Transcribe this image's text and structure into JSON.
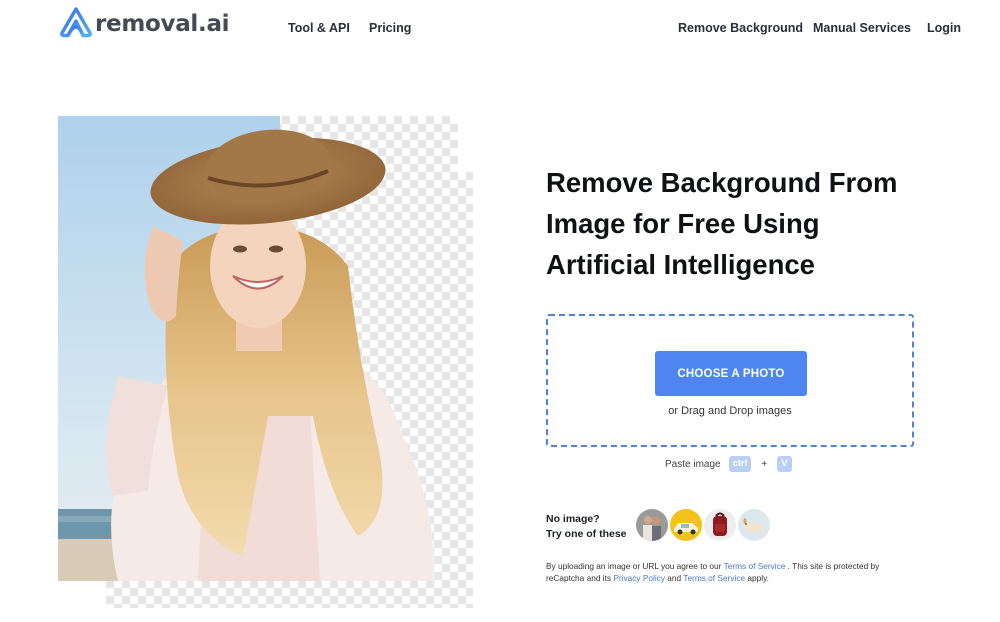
{
  "header": {
    "logo_text": "removal.ai",
    "nav_left": [
      "Tool & API",
      "Pricing"
    ],
    "nav_right": [
      "Remove Background",
      "Manual Services",
      "Login"
    ]
  },
  "hero": {
    "headline_lines": [
      "Remove Background From",
      "Image for Free Using",
      "Artificial Intelligence"
    ]
  },
  "upload": {
    "button_label": "CHOOSE A PHOTO",
    "drag_text": "or Drag and Drop images",
    "paste_label": "Paste image",
    "key_ctrl": "ctrl",
    "plus": "+",
    "key_v": "V"
  },
  "samples": {
    "line1": "No image?",
    "line2": "Try one of these",
    "items": [
      "sample-couple",
      "sample-car",
      "sample-backpack",
      "sample-dog"
    ]
  },
  "legal": {
    "p1": "By uploading an image or URL you agree to our ",
    "terms1": "Terms of Service",
    "p2": " . This site is protected by reCaptcha and its ",
    "privacy": "Privacy Policy",
    "p3": " and ",
    "terms2": "Terms of Service",
    "p4": " apply."
  },
  "colors": {
    "accent": "#4e85f0",
    "dropzone_border": "#4d84d6",
    "key_bg": "#b9d0f6",
    "link": "#4a77c4",
    "logo_gradient": [
      "#3a6ee8",
      "#4fb0f3"
    ]
  }
}
